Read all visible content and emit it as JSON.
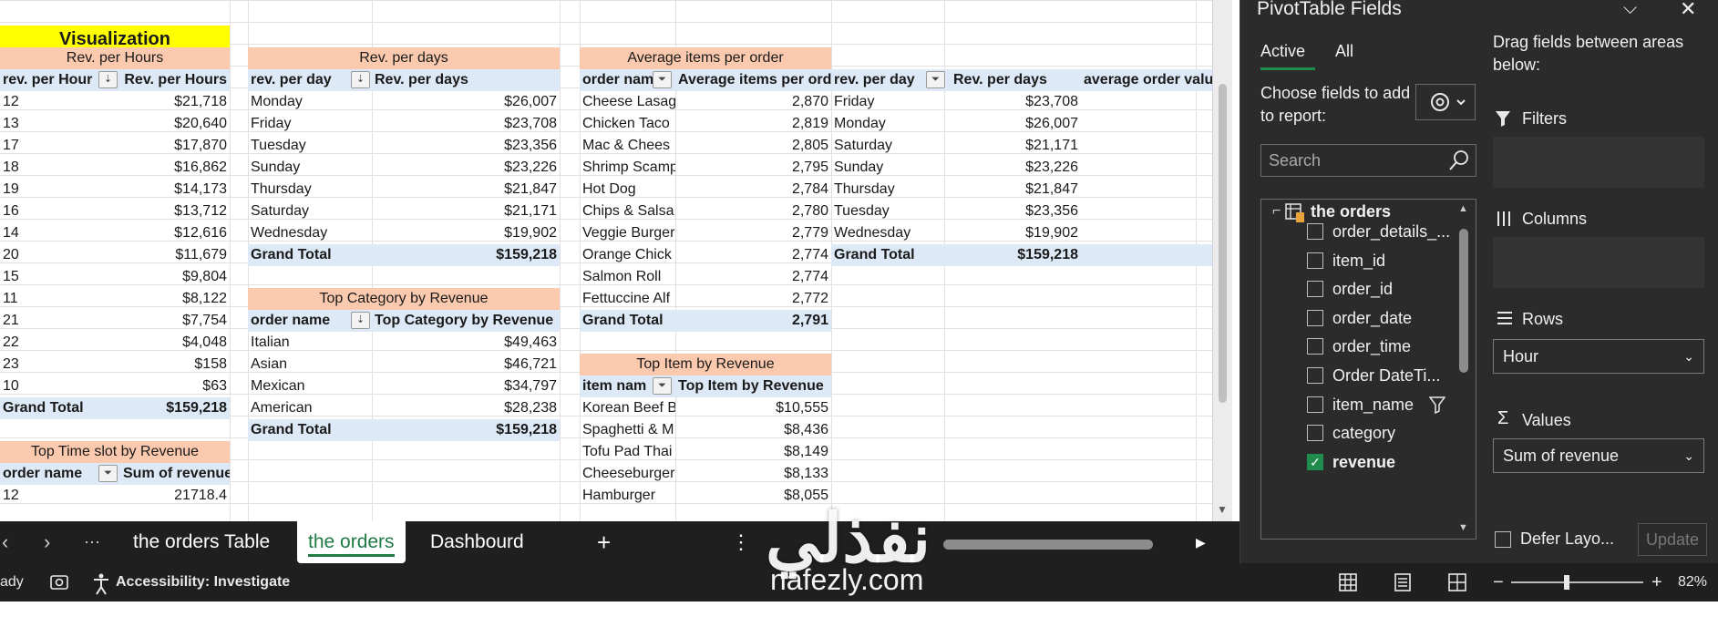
{
  "visualization_title": "Visualization",
  "t1": {
    "title": "Rev. per Hours",
    "col1": "rev. per Hour",
    "col2": "Rev. per Hours",
    "rows": [
      {
        "k": "12",
        "v": "$21,718"
      },
      {
        "k": "13",
        "v": "$20,640"
      },
      {
        "k": "17",
        "v": "$17,870"
      },
      {
        "k": "18",
        "v": "$16,862"
      },
      {
        "k": "19",
        "v": "$14,173"
      },
      {
        "k": "16",
        "v": "$13,712"
      },
      {
        "k": "14",
        "v": "$12,616"
      },
      {
        "k": "20",
        "v": "$11,679"
      },
      {
        "k": "15",
        "v": "$9,804"
      },
      {
        "k": "11",
        "v": "$8,122"
      },
      {
        "k": "21",
        "v": "$7,754"
      },
      {
        "k": "22",
        "v": "$4,048"
      },
      {
        "k": "23",
        "v": "$158"
      },
      {
        "k": "10",
        "v": "$63"
      }
    ],
    "total_label": "Grand Total",
    "total_value": "$159,218"
  },
  "t2": {
    "title": "Rev. per days",
    "col1": "rev. per day",
    "col2": "Rev. per days",
    "rows": [
      {
        "k": "Monday",
        "v": "$26,007"
      },
      {
        "k": "Friday",
        "v": "$23,708"
      },
      {
        "k": "Tuesday",
        "v": "$23,356"
      },
      {
        "k": "Sunday",
        "v": "$23,226"
      },
      {
        "k": "Thursday",
        "v": "$21,847"
      },
      {
        "k": "Saturday",
        "v": "$21,171"
      },
      {
        "k": "Wednesday",
        "v": "$19,902"
      }
    ],
    "total_label": "Grand Total",
    "total_value": "$159,218"
  },
  "t3": {
    "title": "Top Category by Revenue",
    "col1": "order name",
    "col2": "Top Category by Revenue",
    "rows": [
      {
        "k": "Italian",
        "v": "$49,463"
      },
      {
        "k": "Asian",
        "v": "$46,721"
      },
      {
        "k": "Mexican",
        "v": "$34,797"
      },
      {
        "k": "American",
        "v": "$28,238"
      }
    ],
    "total_label": "Grand Total",
    "total_value": "$159,218"
  },
  "t4": {
    "title": "Average items per order",
    "col1": "order nam",
    "col2": "Average items per orde",
    "rows": [
      {
        "k": "Cheese Lasag",
        "v": "2,870"
      },
      {
        "k": "Chicken Taco",
        "v": "2,819"
      },
      {
        "k": "Mac & Chees",
        "v": "2,805"
      },
      {
        "k": "Shrimp Scamp",
        "v": "2,795"
      },
      {
        "k": "Hot Dog",
        "v": "2,784"
      },
      {
        "k": "Chips & Salsa",
        "v": "2,780"
      },
      {
        "k": "Veggie Burger",
        "v": "2,779"
      },
      {
        "k": "Orange Chick",
        "v": "2,774"
      },
      {
        "k": "Salmon Roll",
        "v": "2,774"
      },
      {
        "k": "Fettuccine Alf",
        "v": "2,772"
      }
    ],
    "total_label": "Grand Total",
    "total_value": "2,791"
  },
  "t5": {
    "title": "Top Item by Revenue",
    "col1": "item nam",
    "col2": "Top Item by Revenue",
    "rows": [
      {
        "k": "Korean Beef B",
        "v": "$10,555"
      },
      {
        "k": "Spaghetti & M",
        "v": "$8,436"
      },
      {
        "k": "Tofu Pad Thai",
        "v": "$8,149"
      },
      {
        "k": "Cheeseburger",
        "v": "$8,133"
      },
      {
        "k": "Hamburger",
        "v": "$8,055"
      }
    ]
  },
  "t6": {
    "col1": "rev. per day",
    "col2": "Rev. per days",
    "col3": "average order valu",
    "rows": [
      {
        "k": "Friday",
        "v": "$23,708"
      },
      {
        "k": "Monday",
        "v": "$26,007"
      },
      {
        "k": "Saturday",
        "v": "$21,171"
      },
      {
        "k": "Sunday",
        "v": "$23,226"
      },
      {
        "k": "Thursday",
        "v": "$21,847"
      },
      {
        "k": "Tuesday",
        "v": "$23,356"
      },
      {
        "k": "Wednesday",
        "v": "$19,902"
      }
    ],
    "total_label": "Grand Total",
    "total_value": "$159,218"
  },
  "t7": {
    "title": "Top Time slot by Revenue",
    "col1": "order name",
    "col2": "Sum of revenue",
    "rows": [
      {
        "k": "12",
        "v": "21718.4"
      }
    ]
  },
  "tabs": {
    "t1": "the orders Table",
    "t2": "the orders",
    "t3": "Dashbourd",
    "add": "+",
    "more": "⋯",
    "menu": "⋮"
  },
  "status": {
    "ready": "ady",
    "accessibility": "Accessibility: Investigate",
    "zoom": "82%"
  },
  "pane": {
    "title": "PivotTable Fields",
    "tab_active": "Active",
    "tab_all": "All",
    "choose": "Choose fields to add to report:",
    "drag": "Drag fields between areas below:",
    "search_placeholder": "Search",
    "table_name": "the orders",
    "fields": [
      {
        "name": "order_details_...",
        "checked": false
      },
      {
        "name": "item_id",
        "checked": false
      },
      {
        "name": "order_id",
        "checked": false
      },
      {
        "name": "order_date",
        "checked": false
      },
      {
        "name": "order_time",
        "checked": false
      },
      {
        "name": "Order DateTi...",
        "checked": false
      },
      {
        "name": "item_name",
        "checked": false
      },
      {
        "name": "category",
        "checked": false
      },
      {
        "name": "revenue",
        "checked": true
      }
    ],
    "filters_label": "Filters",
    "columns_label": "Columns",
    "rows_label": "Rows",
    "rows_value": "Hour",
    "values_label": "Values",
    "values_value": "Sum of revenue",
    "defer_label": "Defer Layo...",
    "update_label": "Update"
  },
  "watermark": {
    "arabic": "نفذلي",
    "site": "nafezly.com"
  }
}
